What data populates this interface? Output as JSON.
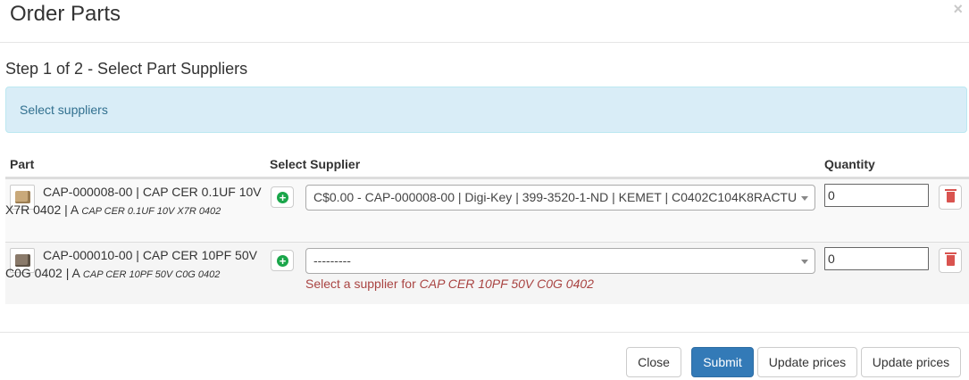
{
  "modal": {
    "title": "Order Parts",
    "close_icon": "×"
  },
  "step": {
    "title": "Step 1 of 2 - Select Part Suppliers"
  },
  "alert": {
    "text": "Select suppliers"
  },
  "table": {
    "headers": {
      "part": "Part",
      "supplier": "Select Supplier",
      "quantity": "Quantity"
    },
    "rows": [
      {
        "part_line": "CAP-000008-00 | CAP CER 0.1UF 10V X7R 0402 | A",
        "part_desc": "CAP CER 0.1UF 10V X7R 0402",
        "supplier_selected": "C$0.00 - CAP-000008-00 | Digi-Key | 399-3520-1-ND | KEMET | C0402C104K8RACTU",
        "quantity": "0",
        "chip_color": "#c9a97a"
      },
      {
        "part_line": "CAP-000010-00 | CAP CER 10PF 50V C0G 0402 | A",
        "part_desc": "CAP CER 10PF 50V C0G 0402",
        "supplier_selected": "---------",
        "quantity": "0",
        "error_prefix": "Select a supplier for",
        "error_part": "CAP CER 10PF 50V C0G 0402",
        "chip_color": "#8a7a6a"
      }
    ]
  },
  "footer": {
    "close": "Close",
    "submit": "Submit",
    "update_prices_1": "Update prices",
    "update_prices_2": "Update prices"
  },
  "colors": {
    "primary": "#337ab7",
    "info_bg": "#d9edf7",
    "info_text": "#31708f",
    "error": "#a94442",
    "add_icon": "#1aa64a",
    "delete_icon": "#d9534f"
  },
  "icons": {
    "add": "plus-circle-icon",
    "delete": "trash-icon",
    "select_arrow": "caret-down-icon",
    "close": "close-icon"
  }
}
